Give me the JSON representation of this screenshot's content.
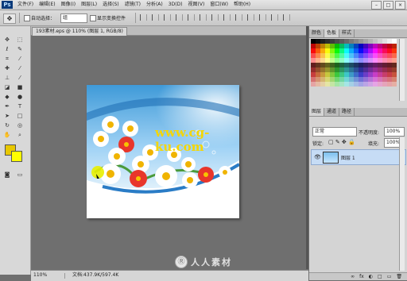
{
  "app": {
    "logo": "Ps"
  },
  "menu": [
    "文件(F)",
    "编辑(E)",
    "图像(I)",
    "图层(L)",
    "选择(S)",
    "滤镜(T)",
    "分析(A)",
    "3D(D)",
    "视图(V)",
    "窗口(W)",
    "帮助(H)"
  ],
  "window_controls": [
    "–",
    "□",
    "×"
  ],
  "options": {
    "tool_icon": "move-tool",
    "auto_select_label": "自动选择：",
    "auto_select_value": "组",
    "show_transform_label": "显示变换控件"
  },
  "document": {
    "tab_label": "193素材.eps @ 110% (图层 1, RGB/8)",
    "watermark_text": "www.cg-ku.com"
  },
  "status": {
    "zoom": "110%",
    "doc_info": "文档:437.9K/597.4K"
  },
  "panels": {
    "color_tabs": [
      "颜色",
      "色板",
      "样式"
    ],
    "layers_tabs": [
      "图层",
      "通道",
      "路径"
    ],
    "blend_mode": "正常",
    "opacity_label": "不透明度:",
    "opacity_value": "100%",
    "lock_label": "锁定:",
    "fill_label": "填充:",
    "fill_value": "100%",
    "layer_name": "图层 1",
    "bottom_icons": [
      "fx",
      "◐",
      "□",
      "▭",
      "🗑"
    ]
  },
  "site_watermark": "人人素材",
  "colors": {
    "accent_fg": "#e8c800",
    "accent_bg": "#ffff00",
    "sky": "#7cc0ee"
  }
}
